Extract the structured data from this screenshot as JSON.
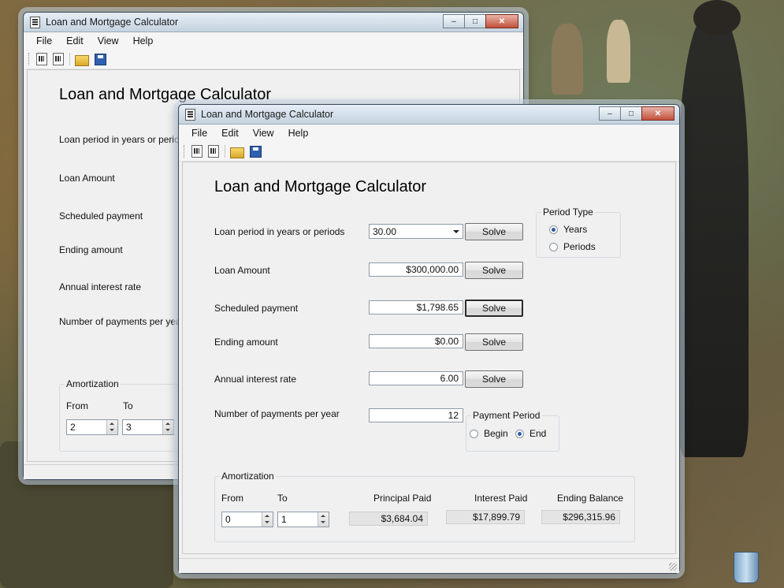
{
  "back_window": {
    "title": "Loan and Mortgage Calculator",
    "menu": [
      "File",
      "Edit",
      "View",
      "Help"
    ],
    "heading": "Loan and Mortgage Calculator",
    "labels": {
      "loan_period": "Loan period in years or periods",
      "loan_amount": "Loan Amount",
      "scheduled_payment": "Scheduled payment",
      "ending_amount": "Ending amount",
      "interest_rate": "Annual interest rate",
      "payments_per_year": "Number of payments per year"
    },
    "amortization": {
      "title": "Amortization",
      "from_label": "From",
      "to_label": "To",
      "from_value": "2",
      "to_value": "3"
    }
  },
  "front_window": {
    "title": "Loan and Mortgage Calculator",
    "menu": [
      "File",
      "Edit",
      "View",
      "Help"
    ],
    "heading": "Loan and Mortgage Calculator",
    "fields": {
      "loan_period": {
        "label": "Loan period in years or periods",
        "value": "30.00"
      },
      "loan_amount": {
        "label": "Loan Amount",
        "value": "$300,000.00"
      },
      "scheduled_payment": {
        "label": "Scheduled payment",
        "value": "$1,798.65"
      },
      "ending_amount": {
        "label": "Ending amount",
        "value": "$0.00"
      },
      "interest_rate": {
        "label": "Annual interest rate",
        "value": "6.00"
      },
      "payments_per_year": {
        "label": "Number of payments per year",
        "value": "12"
      }
    },
    "solve_label": "Solve",
    "period_type": {
      "title": "Period Type",
      "options": [
        "Years",
        "Periods"
      ],
      "selected": "Years"
    },
    "payment_period": {
      "title": "Payment Period",
      "options": [
        "Begin",
        "End"
      ],
      "selected": "End"
    },
    "amortization": {
      "title": "Amortization",
      "from_label": "From",
      "to_label": "To",
      "from_value": "0",
      "to_value": "1",
      "principal_label": "Principal Paid",
      "principal_value": "$3,684.04",
      "interest_label": "Interest Paid",
      "interest_value": "$17,899.79",
      "balance_label": "Ending Balance",
      "balance_value": "$296,315.96"
    }
  },
  "desktop": {
    "icons": [
      "recycle-bin-icon"
    ]
  }
}
